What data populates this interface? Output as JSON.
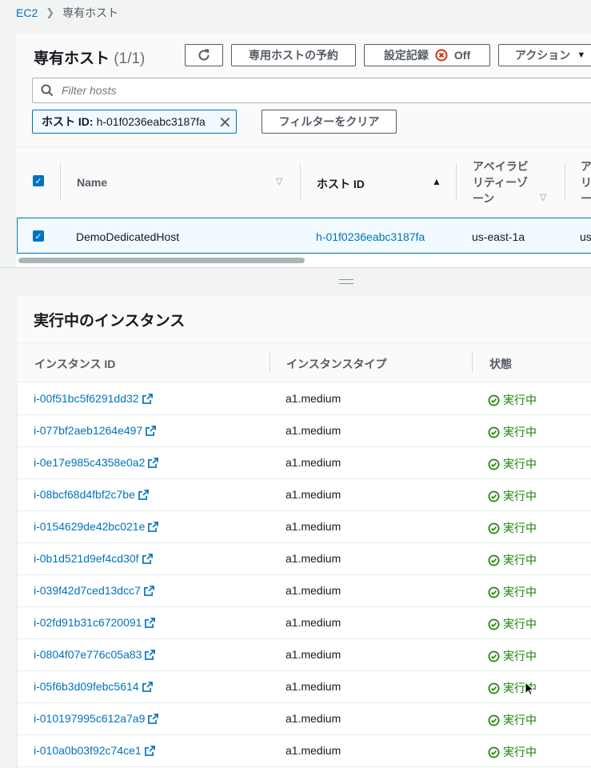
{
  "breadcrumb": {
    "root": "EC2",
    "current": "専有ホスト"
  },
  "hosts_panel": {
    "title": "専有ホスト",
    "count": "(1/1)",
    "reserve_button": "専用ホストの予約",
    "settings_button": "設定記録",
    "settings_state": "Off",
    "actions_button": "アクション",
    "search_placeholder": "Filter hosts",
    "filter_token": {
      "key": "ホスト ID:",
      "value": "h-01f0236eabc3187fa"
    },
    "clear_filters_button": "フィルターをクリア",
    "columns": [
      "Name",
      "ホスト ID",
      "アベイラビリティーゾーン",
      "ア リ ー"
    ],
    "az_header_lines": [
      "アベイラビ",
      "リティーゾ",
      "ーン"
    ],
    "next_col_lines": [
      "ア",
      "リ",
      "ー"
    ],
    "row": {
      "name": "DemoDedicatedHost",
      "host_id": "h-01f0236eabc3187fa",
      "az": "us-east-1a",
      "next": "us"
    }
  },
  "instances_panel": {
    "title": "実行中のインスタンス",
    "columns": [
      "インスタンス ID",
      "インスタンスタイプ",
      "状態"
    ],
    "rows": [
      {
        "id": "i-00f51bc5f6291dd32",
        "type": "a1.medium",
        "state": "実行中"
      },
      {
        "id": "i-077bf2aeb1264e497",
        "type": "a1.medium",
        "state": "実行中"
      },
      {
        "id": "i-0e17e985c4358e0a2",
        "type": "a1.medium",
        "state": "実行中"
      },
      {
        "id": "i-08bcf68d4fbf2c7be",
        "type": "a1.medium",
        "state": "実行中"
      },
      {
        "id": "i-0154629de42bc021e",
        "type": "a1.medium",
        "state": "実行中"
      },
      {
        "id": "i-0b1d521d9ef4cd30f",
        "type": "a1.medium",
        "state": "実行中"
      },
      {
        "id": "i-039f42d7ced13dcc7",
        "type": "a1.medium",
        "state": "実行中"
      },
      {
        "id": "i-02fd91b31c6720091",
        "type": "a1.medium",
        "state": "実行中"
      },
      {
        "id": "i-0804f07e776c05a83",
        "type": "a1.medium",
        "state": "実行中"
      },
      {
        "id": "i-05f6b3d09febc5614",
        "type": "a1.medium",
        "state": "実行中"
      },
      {
        "id": "i-010197995c612a7a9",
        "type": "a1.medium",
        "state": "実行中"
      },
      {
        "id": "i-010a0b03f92c74ce1",
        "type": "a1.medium",
        "state": "実行中"
      }
    ]
  },
  "colors": {
    "link": "#0073bb",
    "success": "#1d8102",
    "error": "#d13212"
  },
  "icons": [
    "chevron-right-icon",
    "refresh-icon",
    "error-circle-icon",
    "caret-down-icon",
    "search-icon",
    "close-icon",
    "checkbox-icon",
    "sort-icon",
    "external-link-icon",
    "success-circle-icon"
  ]
}
